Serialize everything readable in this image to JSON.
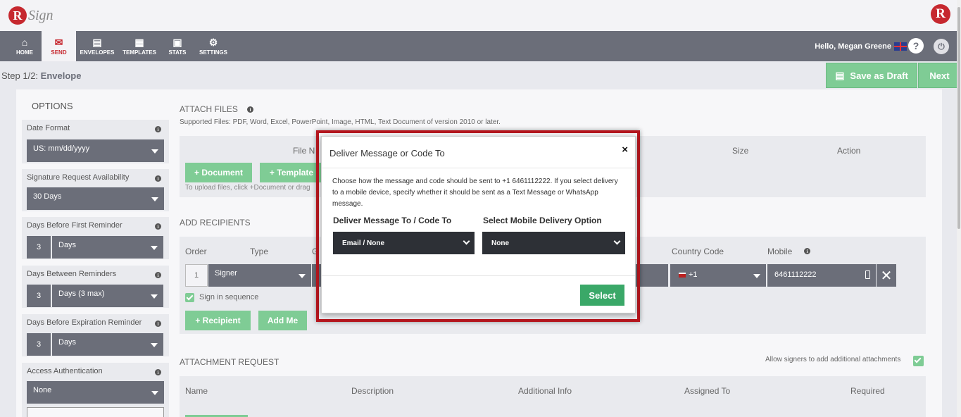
{
  "app": {
    "logo_text": "Sign",
    "logo_letter": "R"
  },
  "nav": {
    "items": [
      {
        "label": "HOME",
        "icon": "home-icon"
      },
      {
        "label": "SEND",
        "icon": "envelope-icon"
      },
      {
        "label": "ENVELOPES",
        "icon": "inbox-icon"
      },
      {
        "label": "TEMPLATES",
        "icon": "document-icon"
      },
      {
        "label": "STATS",
        "icon": "briefcase-icon"
      },
      {
        "label": "SETTINGS",
        "icon": "gear-icon"
      }
    ],
    "active": "SEND",
    "greeting": "Hello, Megan Greene",
    "help_glyph": "?",
    "power_glyph": "⏻"
  },
  "toolbar": {
    "step_prefix": "Step 1/2:",
    "step_name": "Envelope",
    "save_draft": "Save as Draft",
    "next": "Next"
  },
  "options": {
    "title": "OPTIONS",
    "date_format": {
      "label": "Date Format",
      "value": "US: mm/dd/yyyy"
    },
    "availability": {
      "label": "Signature Request Availability",
      "value": "30 Days"
    },
    "first_reminder": {
      "label": "Days Before First Reminder",
      "number": "3",
      "unit": "Days"
    },
    "between_reminders": {
      "label": "Days Between Reminders",
      "number": "3",
      "unit": "Days (3 max)"
    },
    "expiration_reminder": {
      "label": "Days Before Expiration Reminder",
      "number": "3",
      "unit": "Days"
    },
    "access_auth": {
      "label": "Access Authentication",
      "value": "None"
    }
  },
  "attach": {
    "title": "ATTACH FILES",
    "supported": "Supported Files: PDF, Word, Excel, PowerPoint, Image, HTML, Text Document of version 2010 or later.",
    "col_filename": "File N",
    "col_size": "Size",
    "col_action": "Action",
    "btn_document": "+ Document",
    "btn_template": "+ Template",
    "hint": "To upload files, click +Document or drag"
  },
  "recipients": {
    "title": "ADD RECIPIENTS",
    "col_order": "Order",
    "col_type": "Type",
    "col_g": "G",
    "col_country": "Country Code",
    "col_mobile": "Mobile",
    "row": {
      "order": "1",
      "type": "Signer",
      "country": "+1",
      "mobile": "6461112222"
    },
    "sequence_label": "Sign in sequence",
    "btn_recipient": "+ Recipient",
    "btn_add_me": "Add Me"
  },
  "attachment_request": {
    "title": "ATTACHMENT REQUEST",
    "allow_label": "Allow signers to add additional attachments",
    "cols": [
      "Name",
      "Description",
      "Additional Info",
      "Assigned To",
      "Required"
    ]
  },
  "modal": {
    "title": "Deliver Message or Code To",
    "close": "×",
    "description": "Choose how the message and code should be sent to +1 6461112222. If you select delivery to a mobile device, specify whether it should be sent as a Text Message or WhatsApp message.",
    "deliver_label": "Deliver Message To / Code To",
    "deliver_value": "Email / None",
    "mobile_label": "Select Mobile Delivery Option",
    "mobile_value": "None",
    "select_button": "Select"
  },
  "colors": {
    "brand_red": "#c6282f",
    "nav_gray": "#6b6e79",
    "green": "#7fcc95",
    "modal_select": "#2d3036"
  }
}
